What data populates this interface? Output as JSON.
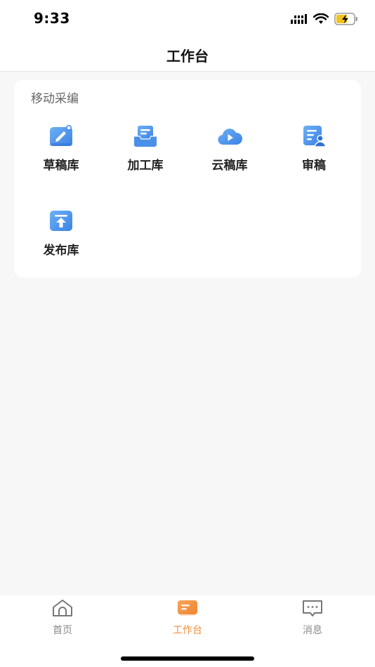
{
  "status_bar": {
    "time": "9:33"
  },
  "nav": {
    "title": "工作台"
  },
  "section": {
    "title": "移动采编",
    "items": [
      {
        "label": "草稿库",
        "icon": "edit-document-icon"
      },
      {
        "label": "加工库",
        "icon": "inbox-tray-icon"
      },
      {
        "label": "云稿库",
        "icon": "cloud-play-icon"
      },
      {
        "label": "审稿",
        "icon": "document-user-icon"
      },
      {
        "label": "发布库",
        "icon": "publish-upload-icon"
      }
    ]
  },
  "tabbar": {
    "items": [
      {
        "label": "首页",
        "icon": "home-icon",
        "active": false
      },
      {
        "label": "工作台",
        "icon": "workbench-icon",
        "active": true
      },
      {
        "label": "消息",
        "icon": "message-icon",
        "active": false
      }
    ]
  },
  "colors": {
    "accent": "#ef8e3a",
    "icon_blue": "#4a8fe8",
    "inactive": "#8a8a8a"
  }
}
